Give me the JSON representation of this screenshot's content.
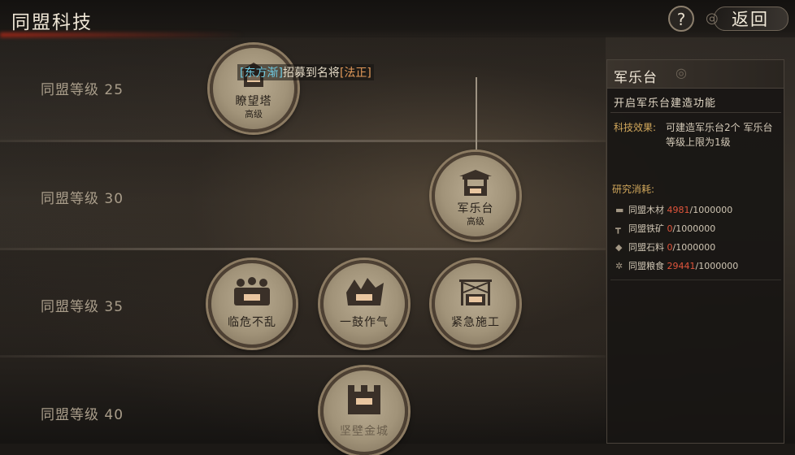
{
  "header": {
    "title": "同盟科技",
    "help_label": "?",
    "back_label": "返回"
  },
  "notice": {
    "name1": "[东方渐]",
    "middle": "招募到名将",
    "name2": "[法正]"
  },
  "levels": [
    {
      "label": "同盟等级 25"
    },
    {
      "label": "同盟等级 30"
    },
    {
      "label": "同盟等级 35"
    },
    {
      "label": "同盟等级 40"
    }
  ],
  "nodes": {
    "tower": {
      "name": "瞭望塔",
      "sub": "高级",
      "icon": "watchtower-icon"
    },
    "music": {
      "name": "军乐台",
      "sub": "高级",
      "icon": "music-stage-icon"
    },
    "crisis": {
      "name": "临危不乱",
      "sub": "",
      "icon": "soldiers-icon"
    },
    "drum": {
      "name": "一鼓作气",
      "sub": "",
      "icon": "warriors-icon"
    },
    "build": {
      "name": "紧急施工",
      "sub": "",
      "icon": "scaffold-icon"
    },
    "wall": {
      "name": "坚壁金城",
      "sub": "",
      "icon": "wall-icon"
    }
  },
  "panel": {
    "title": "军乐台",
    "desc": "开启军乐台建造功能",
    "effect_label": "科技效果:",
    "effect_text": "可建造军乐台2个 军乐台等级上限为1级",
    "cost_title": "研究消耗:",
    "costs": [
      {
        "name": "同盟木材",
        "have": "4981",
        "need": "/1000000",
        "icon": "wood-icon"
      },
      {
        "name": "同盟铁矿",
        "have": "0",
        "need": "/1000000",
        "icon": "iron-icon"
      },
      {
        "name": "同盟石料",
        "have": "0",
        "need": "/1000000",
        "icon": "stone-icon"
      },
      {
        "name": "同盟粮食",
        "have": "29441",
        "need": "/1000000",
        "icon": "grain-icon"
      }
    ]
  }
}
